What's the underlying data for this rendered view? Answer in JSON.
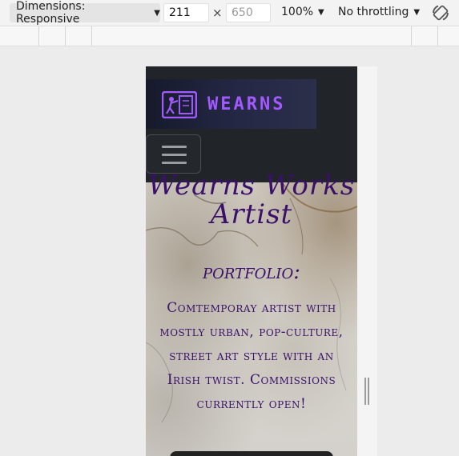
{
  "toolbar": {
    "dimensions_label": "Dimensions: Responsive",
    "width_value": "211",
    "height_placeholder": "650",
    "times_symbol": "×",
    "zoom_label": "100%",
    "throttle_label": "No throttling",
    "caret_icon": "chevron-down-icon",
    "rotate_icon": "rotate-icon"
  },
  "site": {
    "brand_name": "WEARNS",
    "hero_title": "Wearns Works Artist",
    "hero_subtitle": "portfolio:",
    "hero_description": "Comtemporay artist with mostly urban, pop-culture, street art style with an Irish twist. Commissions currently open!"
  },
  "colors": {
    "navbar_bg": "#212529",
    "brand_text": "#a259ff",
    "hero_text": "#3a1069"
  }
}
